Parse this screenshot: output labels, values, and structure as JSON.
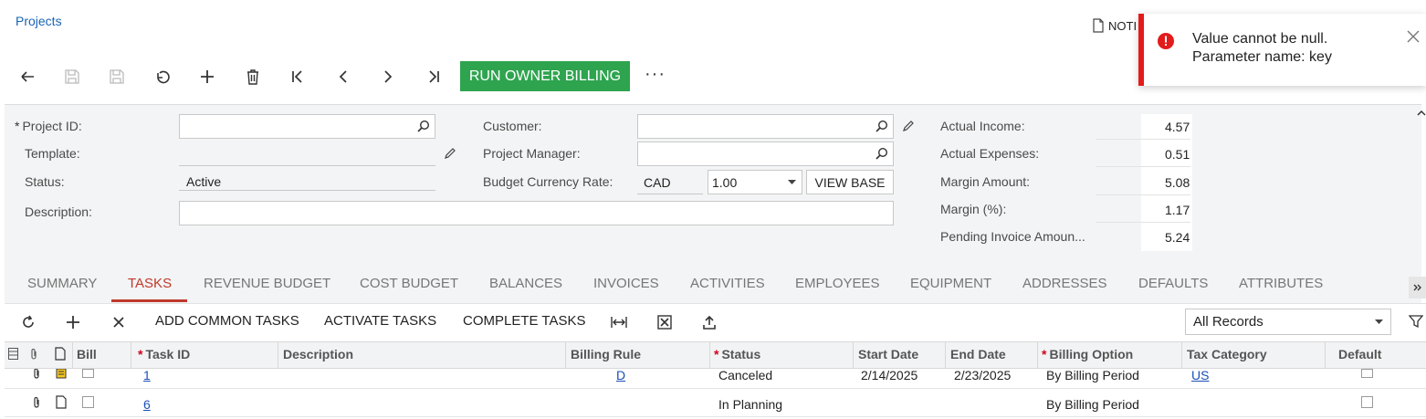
{
  "breadcrumb": "Projects",
  "notes_label": "NOTI",
  "toolbar": {
    "run_owner_billing": "RUN OWNER BILLING",
    "more": "···"
  },
  "form": {
    "project_id_label": "Project ID:",
    "template_label": "Template:",
    "status_label": "Status:",
    "status_value": "Active",
    "description_label": "Description:",
    "customer_label": "Customer:",
    "project_manager_label": "Project Manager:",
    "budget_currency_rate_label": "Budget Currency Rate:",
    "currency": "CAD",
    "rate": "1.00",
    "view_base": "VIEW BASE",
    "actual_income_label": "Actual Income:",
    "actual_income_value": "4.57",
    "actual_expenses_label": "Actual Expenses:",
    "actual_expenses_value": "0.51",
    "margin_amount_label": "Margin Amount:",
    "margin_amount_value": "5.08",
    "margin_pct_label": "Margin (%):",
    "margin_pct_value": "1.17",
    "pending_invoice_label": "Pending Invoice Amoun...",
    "pending_invoice_value": "5.24"
  },
  "tabs": [
    {
      "label": "SUMMARY"
    },
    {
      "label": "TASKS"
    },
    {
      "label": "REVENUE BUDGET"
    },
    {
      "label": "COST BUDGET"
    },
    {
      "label": "BALANCES"
    },
    {
      "label": "INVOICES"
    },
    {
      "label": "ACTIVITIES"
    },
    {
      "label": "EMPLOYEES"
    },
    {
      "label": "EQUIPMENT"
    },
    {
      "label": "ADDRESSES"
    },
    {
      "label": "DEFAULTS"
    },
    {
      "label": "ATTRIBUTES"
    }
  ],
  "active_tab": "TASKS",
  "grid_toolbar": {
    "add_common_tasks": "ADD COMMON TASKS",
    "activate_tasks": "ACTIVATE TASKS",
    "complete_tasks": "COMPLETE TASKS",
    "filter_value": "All Records"
  },
  "grid": {
    "columns": [
      "Bill",
      "Task ID",
      "Description",
      "Billing Rule",
      "Status",
      "Start Date",
      "End Date",
      "Billing Option",
      "Tax Category",
      "Default"
    ],
    "rows": [
      {
        "task_id": "1",
        "description": "",
        "billing_rule": "D",
        "status": "Canceled",
        "start_date": "2/14/2025",
        "end_date": "2/23/2025",
        "billing_option": "By Billing Period",
        "tax_category": "US"
      },
      {
        "task_id": "6",
        "description": "",
        "billing_rule": "",
        "status": "In Planning",
        "start_date": "",
        "end_date": "",
        "billing_option": "By Billing Period",
        "tax_category": ""
      }
    ]
  },
  "toast": {
    "line1": "Value cannot be null.",
    "line2": "Parameter name: key"
  },
  "colors": {
    "primary_action": "#2ea44f",
    "active_tab": "#c0392b",
    "link": "#1a4fb5",
    "error": "#e31b1b"
  }
}
